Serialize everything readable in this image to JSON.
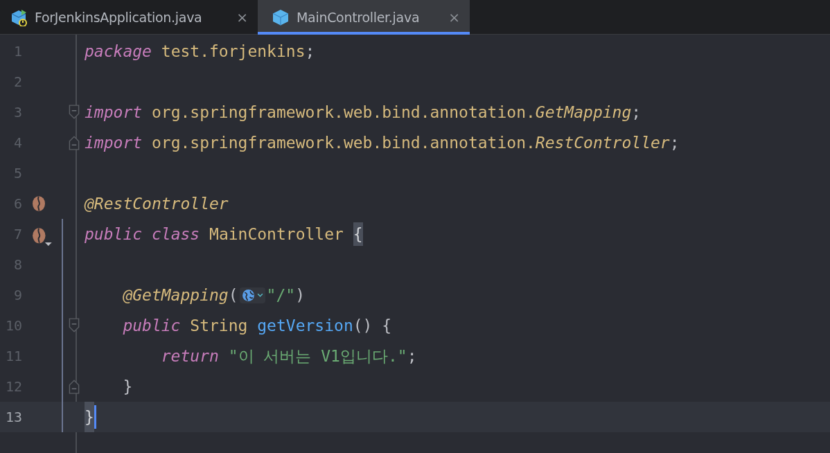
{
  "tabs": [
    {
      "label": "ForJenkinsApplication.java",
      "close": "×",
      "selected": false
    },
    {
      "label": "MainController.java",
      "close": "×",
      "selected": true
    }
  ],
  "editor": {
    "lines": [
      {
        "number": "1",
        "selected": false,
        "scope": false,
        "tokens": [
          {
            "kind": "keyword",
            "text": "package"
          },
          {
            "kind": "name",
            "text": " test.forjenkins"
          },
          {
            "kind": "plain",
            "text": ";"
          }
        ]
      },
      {
        "number": "2",
        "selected": false,
        "scope": false
      },
      {
        "number": "3",
        "selected": false,
        "scope": false,
        "fold_start": true,
        "tokens": [
          {
            "kind": "keyword",
            "text": "import"
          },
          {
            "kind": "name",
            "text": " org.springframework.web.bind.annotation."
          },
          {
            "kind": "type",
            "text": "GetMapping"
          },
          {
            "kind": "plain",
            "text": ";"
          }
        ]
      },
      {
        "number": "4",
        "selected": false,
        "scope": false,
        "fold_end": true,
        "tokens": [
          {
            "kind": "keyword",
            "text": "import"
          },
          {
            "kind": "name",
            "text": " org.springframework.web.bind.annotation."
          },
          {
            "kind": "type",
            "text": "RestController"
          },
          {
            "kind": "plain",
            "text": ";"
          }
        ]
      },
      {
        "number": "5",
        "selected": false,
        "scope": false
      },
      {
        "number": "6",
        "selected": false,
        "scope": false,
        "bean": true,
        "tokens": [
          {
            "kind": "annotation",
            "text": "@RestController"
          }
        ]
      },
      {
        "number": "7",
        "selected": false,
        "scope": true,
        "bean": true,
        "bean_menu": true,
        "tokens": [
          {
            "kind": "keyword",
            "text": "public"
          },
          {
            "kind": "keyword",
            "text": " class"
          },
          {
            "kind": "name",
            "text": " MainController "
          },
          {
            "kind": "brace-match",
            "text": "{"
          }
        ]
      },
      {
        "number": "8",
        "selected": false,
        "scope": true
      },
      {
        "number": "9",
        "selected": false,
        "scope": true,
        "tokens": [
          {
            "kind": "annotation",
            "text": "    @GetMapping"
          },
          {
            "kind": "plain",
            "text": "("
          },
          {
            "kind": "inlay"
          },
          {
            "kind": "string",
            "text": "\"/\""
          },
          {
            "kind": "plain",
            "text": ")"
          }
        ]
      },
      {
        "number": "10",
        "selected": false,
        "scope": true,
        "fold_start": true,
        "tokens": [
          {
            "kind": "keyword",
            "text": "    public"
          },
          {
            "kind": "name",
            "text": " String "
          },
          {
            "kind": "method",
            "text": "getVersion"
          },
          {
            "kind": "plain",
            "text": "() {"
          }
        ]
      },
      {
        "number": "11",
        "selected": false,
        "scope": true,
        "tokens": [
          {
            "kind": "keyword",
            "text": "        return"
          },
          {
            "kind": "string",
            "text": " \"이 서버는 V1입니다.\""
          },
          {
            "kind": "plain",
            "text": ";"
          }
        ]
      },
      {
        "number": "12",
        "selected": false,
        "scope": true,
        "fold_end": true,
        "tokens": [
          {
            "kind": "plain",
            "text": "    }"
          }
        ]
      },
      {
        "number": "13",
        "selected": true,
        "scope": true,
        "caret": true,
        "tokens": [
          {
            "kind": "brace-match",
            "text": "}"
          }
        ]
      }
    ]
  }
}
